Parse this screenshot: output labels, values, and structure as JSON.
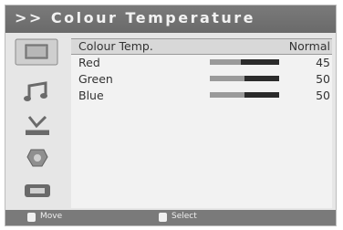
{
  "title": ">> Colour Temperature",
  "menu": {
    "rows": [
      {
        "label": "Colour Temp.",
        "value": "Normal",
        "selected": true
      },
      {
        "label": "Red",
        "value": "45",
        "level": 0.45
      },
      {
        "label": "Green",
        "value": "50",
        "level": 0.5
      },
      {
        "label": "Blue",
        "value": "50",
        "level": 0.5
      }
    ]
  },
  "sidebar": {
    "icons": [
      "picture-icon",
      "sound-icon",
      "setup-icon",
      "feature-icon",
      "source-icon"
    ]
  },
  "footer": {
    "move_label": "Move",
    "select_label": "Select"
  }
}
